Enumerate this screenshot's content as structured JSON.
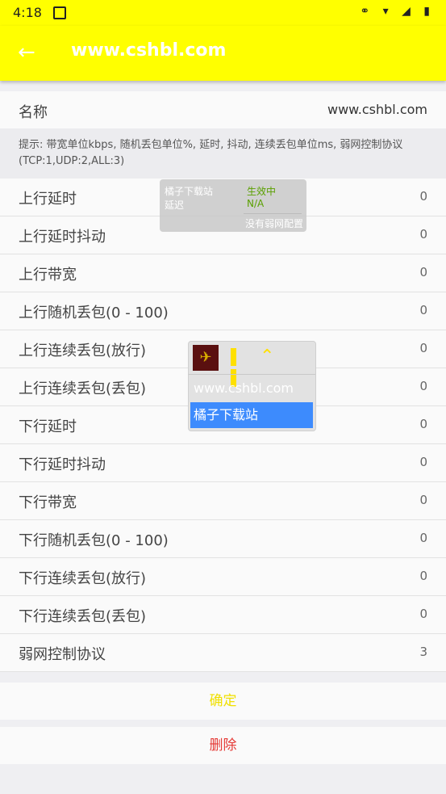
{
  "status_bar": {
    "time": "4:18",
    "icons": "⚭ ▾ ◢ ▮"
  },
  "app_bar": {
    "title": "www.cshbl.com",
    "back_icon": "arrow-back-icon"
  },
  "name_row": {
    "label": "名称",
    "value": "www.cshbl.com"
  },
  "hint": "提示: 带宽单位kbps, 随机丢包单位%, 延时, 抖动, 连续丢包单位ms, 弱网控制协议(TCP:1,UDP:2,ALL:3)",
  "rows": [
    {
      "label": "上行延时",
      "value": "0"
    },
    {
      "label": "上行延时抖动",
      "value": "0"
    },
    {
      "label": "上行带宽",
      "value": "0"
    },
    {
      "label": "上行随机丢包(0 - 100)",
      "value": "0"
    },
    {
      "label": "上行连续丢包(放行)",
      "value": "0"
    },
    {
      "label": "上行连续丢包(丢包)",
      "value": "0"
    },
    {
      "label": "下行延时",
      "value": "0"
    },
    {
      "label": "下行延时抖动",
      "value": "0"
    },
    {
      "label": "下行带宽",
      "value": "0"
    },
    {
      "label": "下行随机丢包(0 - 100)",
      "value": "0"
    },
    {
      "label": "下行连续丢包(放行)",
      "value": "0"
    },
    {
      "label": "下行连续丢包(丢包)",
      "value": "0"
    },
    {
      "label": "弱网控制协议",
      "value": "3"
    }
  ],
  "buttons": {
    "confirm": "确定",
    "delete": "删除"
  },
  "status_popup": {
    "app_name": "橘子下载站",
    "state": "生效中",
    "latency_label": "延迟",
    "latency_value": "N/A",
    "note": "没有弱网配置"
  },
  "floating_window": {
    "icon_glyph": "✈",
    "option_1": "www.cshbl.com",
    "option_2": "橘子下载站"
  },
  "colors": {
    "accent": "#ffff00",
    "delete": "#e53935",
    "selected": "#3d8bfd"
  }
}
